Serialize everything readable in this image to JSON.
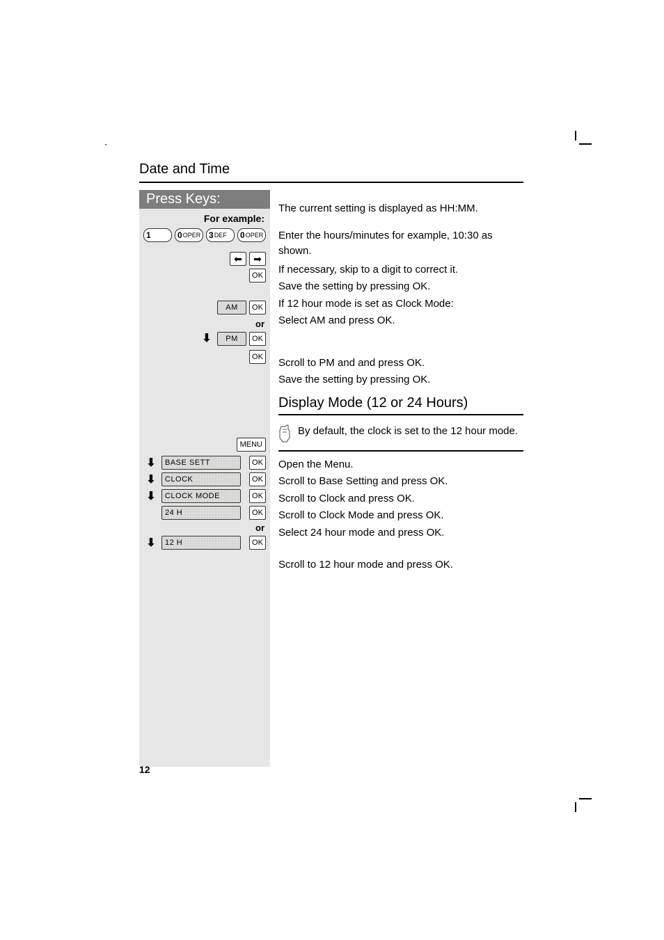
{
  "crop_backtick": "`",
  "section_title": "Date and Time",
  "press_keys_header": "Press Keys:",
  "for_example_label": "For example:",
  "keypad_keys": [
    {
      "digit": "1",
      "sub": ""
    },
    {
      "digit": "0",
      "sub": "OPER"
    },
    {
      "digit": "3",
      "sub": "DEF"
    },
    {
      "digit": "0",
      "sub": "OPER"
    }
  ],
  "arrows": {
    "left": "⬅",
    "right": "➡",
    "down": "⬇"
  },
  "labels": {
    "ok": "OK",
    "am": "AM",
    "pm": "PM",
    "or": "or",
    "menu": "MENU",
    "base_sett": "BASE SETT",
    "clock": "CLOCK",
    "clock_mode": "CLOCK MODE",
    "h24": "24 H",
    "h12": "12 H"
  },
  "right": {
    "l1": "The current setting is displayed as HH:MM.",
    "l2": "Enter the hours/minutes for example, 10:30 as shown.",
    "l3": "If necessary, skip to a digit to correct it.",
    "l4": "Save the setting by pressing OK.",
    "l5": "If 12 hour mode is set as Clock Mode:",
    "l6": "Select AM and press OK.",
    "l7": "Scroll to PM and and press OK.",
    "l8": "Save the setting by pressing OK.",
    "subsection": "Display Mode (12 or 24 Hours)",
    "note": "By default, the clock is set to the 12 hour mode.",
    "m1": "Open the Menu.",
    "m2": "Scroll to Base Setting and press OK.",
    "m3": "Scroll to Clock and press OK.",
    "m4": "Scroll to Clock Mode and press OK.",
    "m5": "Select 24 hour mode and press OK.",
    "m6": "Scroll to 12 hour mode and press OK."
  },
  "page_number": "12"
}
